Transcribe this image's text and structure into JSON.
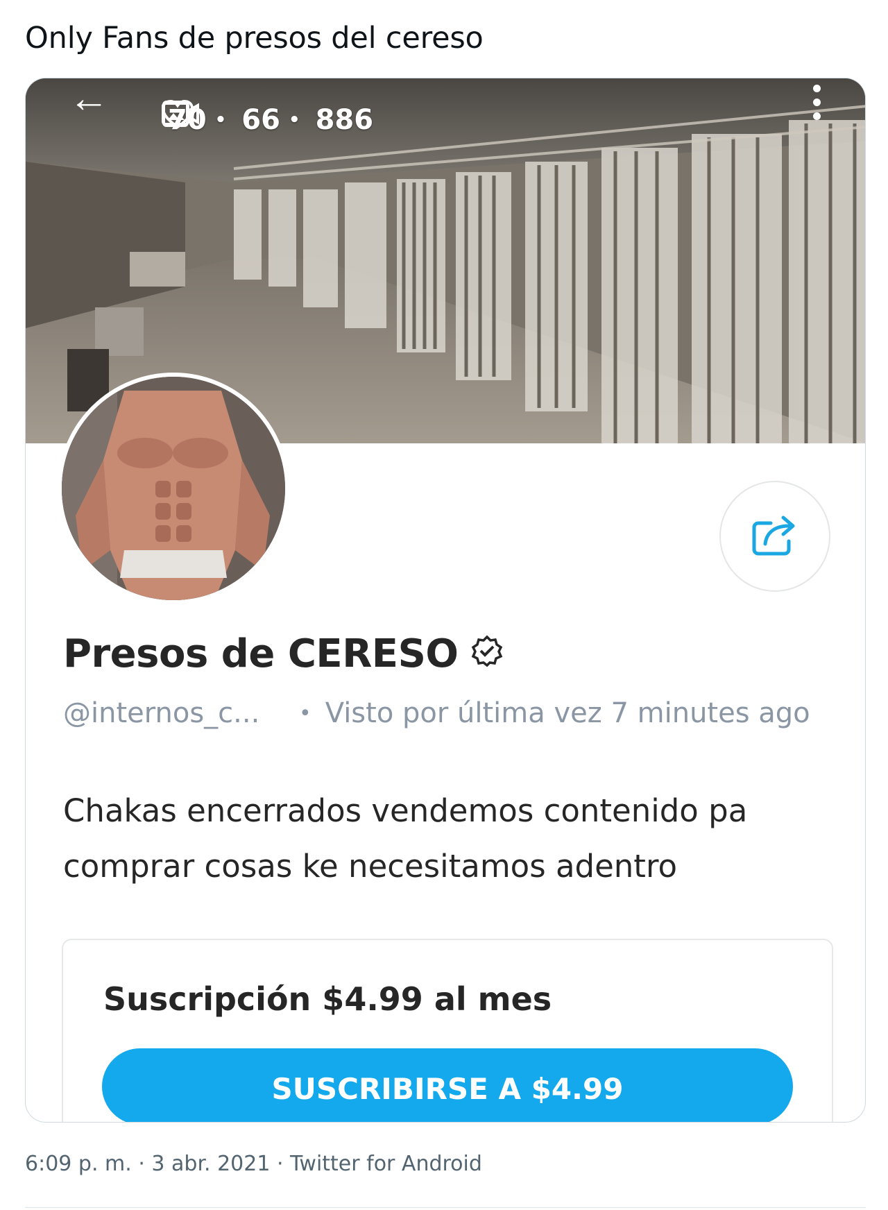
{
  "tweet": {
    "text": "Only Fans de presos del cereso",
    "timestamp": "6:09 p. m. · 3 abr. 2021 · Twitter for Android"
  },
  "profile_header": {
    "stats": {
      "photos": "70",
      "videos": "66",
      "likes": "886",
      "separator": "•"
    },
    "icons": {
      "back": "back-arrow-icon",
      "more": "more-vertical-icon",
      "photos": "image-icon",
      "videos": "video-icon",
      "likes": "heart-icon",
      "share": "share-icon",
      "verified": "verified-badge-icon"
    }
  },
  "profile": {
    "name": "Presos de CERESO",
    "handle": "@internos_c...",
    "separator": "•",
    "last_seen": "Visto por última vez 7 minutes ago",
    "bio": "Chakas encerrados vendemos contenido pa comprar cosas ke necesitamos adentro"
  },
  "subscription": {
    "title": "Suscripción $4.99 al mes",
    "button_label": "SUSCRIBIRSE A $4.99"
  },
  "colors": {
    "accent": "#14a9ec",
    "text": "#262626",
    "muted": "#8a96a3"
  }
}
